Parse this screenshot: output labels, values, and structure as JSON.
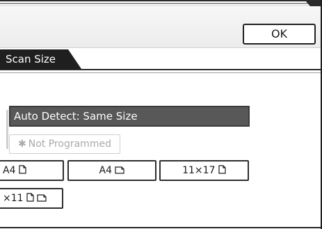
{
  "header": {
    "ok_label": "OK"
  },
  "tabs": {
    "scan_size_label": "Scan Size"
  },
  "scan_size": {
    "auto_detect_label": "Auto Detect: Same Size",
    "not_programmed_label": "Not Programmed",
    "not_programmed_star": "✱",
    "buttons": {
      "a4_portrait": "A4",
      "a4_landscape": "A4",
      "size_11x17": "11×17",
      "size_8x11": "×11"
    }
  },
  "colors": {
    "selected_fill": "#585858",
    "tab_fill": "#1f1f1f",
    "disabled_text": "#a9a9a9"
  },
  "icons": {
    "portrait": "portrait-paper-icon",
    "landscape": "landscape-paper-icon"
  }
}
